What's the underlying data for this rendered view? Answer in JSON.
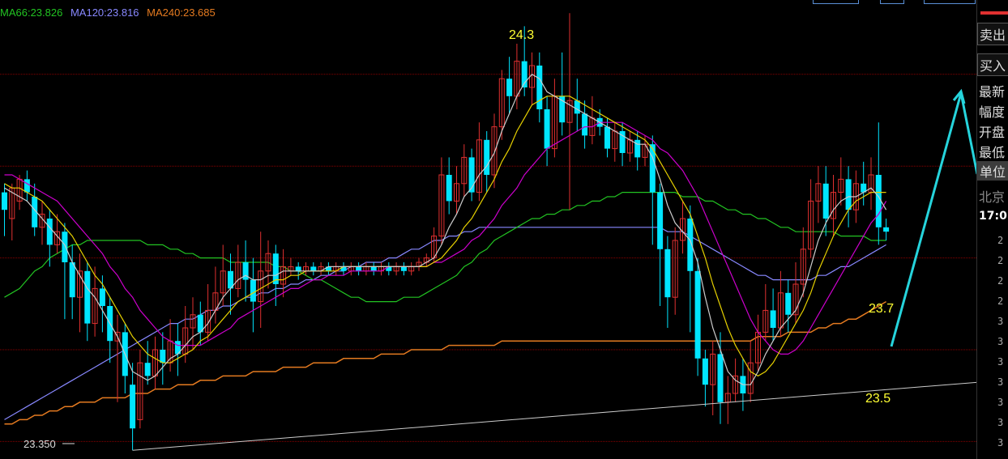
{
  "legend": [
    {
      "text": "MA66:23.826",
      "color": "#22c322"
    },
    {
      "text": "MA120:23.816",
      "color": "#8888ff"
    },
    {
      "text": "MA240:23.685",
      "color": "#e47a20"
    }
  ],
  "right_panel": {
    "sell_tab": "卖出",
    "buy_tab": "买入",
    "items": [
      "最新",
      "幅度",
      "开盘",
      "最低",
      "单位"
    ],
    "location": "北京",
    "time": "17:0",
    "rows": [
      "2",
      "2",
      "2",
      "2",
      "3",
      "3",
      "3",
      "3",
      "3",
      "3",
      "3"
    ]
  },
  "annotations": [
    {
      "label": "24.3",
      "color": "#ffff33"
    },
    {
      "label": "23.7",
      "color": "#ffff33"
    },
    {
      "label": "23.5",
      "color": "#ffff33"
    },
    {
      "label": "23.350",
      "color": "#dddddd"
    }
  ],
  "chart_data": {
    "type": "candlestick",
    "ylim": [
      23.33,
      24.38
    ],
    "n_candles": 118,
    "grid_levels": [
      24.21,
      24.0,
      23.79,
      23.58,
      23.37
    ],
    "colors": {
      "up": "#e03030",
      "down": "#00e5ff",
      "grid": "#8b0000",
      "price_line": "#cccccc",
      "ma_yellow": "#e6d000",
      "ma_magenta": "#cc00cc"
    },
    "candles": [
      [
        23.94,
        23.9,
        23.96,
        23.84
      ],
      [
        23.88,
        23.95,
        23.96,
        23.83
      ],
      [
        23.92,
        23.97,
        23.98,
        23.9
      ],
      [
        23.97,
        23.94,
        23.99,
        23.92
      ],
      [
        23.93,
        23.86,
        23.96,
        23.84
      ],
      [
        23.86,
        23.89,
        23.92,
        23.82
      ],
      [
        23.88,
        23.82,
        23.9,
        23.77
      ],
      [
        23.82,
        23.85,
        23.89,
        23.8
      ],
      [
        23.85,
        23.78,
        23.87,
        23.65
      ],
      [
        23.78,
        23.7,
        23.82,
        23.65
      ],
      [
        23.7,
        23.76,
        23.8,
        23.62
      ],
      [
        23.76,
        23.64,
        23.78,
        23.6
      ],
      [
        23.64,
        23.72,
        23.77,
        23.61
      ],
      [
        23.72,
        23.68,
        23.75,
        23.62
      ],
      [
        23.68,
        23.6,
        23.7,
        23.55
      ],
      [
        23.6,
        23.62,
        23.66,
        23.46
      ],
      [
        23.62,
        23.52,
        23.64,
        23.48
      ],
      [
        23.5,
        23.4,
        23.55,
        23.35
      ],
      [
        23.42,
        23.55,
        23.58,
        23.4
      ],
      [
        23.55,
        23.52,
        23.6,
        23.5
      ],
      [
        23.52,
        23.58,
        23.61,
        23.49
      ],
      [
        23.58,
        23.55,
        23.62,
        23.5
      ],
      [
        23.55,
        23.6,
        23.65,
        23.53
      ],
      [
        23.6,
        23.57,
        23.64,
        23.52
      ],
      [
        23.57,
        23.63,
        23.68,
        23.55
      ],
      [
        23.63,
        23.66,
        23.7,
        23.58
      ],
      [
        23.66,
        23.62,
        23.69,
        23.59
      ],
      [
        23.62,
        23.67,
        23.73,
        23.6
      ],
      [
        23.67,
        23.71,
        23.77,
        23.64
      ],
      [
        23.71,
        23.76,
        23.82,
        23.68
      ],
      [
        23.76,
        23.72,
        23.8,
        23.66
      ],
      [
        23.72,
        23.78,
        23.82,
        23.7
      ],
      [
        23.78,
        23.74,
        23.83,
        23.69
      ],
      [
        23.74,
        23.69,
        23.79,
        23.62
      ],
      [
        23.69,
        23.76,
        23.85,
        23.63
      ],
      [
        23.76,
        23.8,
        23.83,
        23.72
      ],
      [
        23.8,
        23.73,
        23.82,
        23.68
      ],
      [
        23.73,
        23.77,
        23.81,
        23.7
      ],
      [
        23.76,
        23.77,
        23.79,
        23.75
      ],
      [
        23.77,
        23.76,
        23.78,
        23.74
      ],
      [
        23.76,
        23.77,
        23.78,
        23.75
      ],
      [
        23.77,
        23.76,
        23.78,
        23.75
      ],
      [
        23.76,
        23.77,
        23.78,
        23.75
      ],
      [
        23.77,
        23.76,
        23.78,
        23.75
      ],
      [
        23.76,
        23.77,
        23.78,
        23.75
      ],
      [
        23.77,
        23.76,
        23.78,
        23.75
      ],
      [
        23.76,
        23.77,
        23.78,
        23.75
      ],
      [
        23.77,
        23.76,
        23.78,
        23.75
      ],
      [
        23.76,
        23.77,
        23.78,
        23.75
      ],
      [
        23.77,
        23.76,
        23.78,
        23.75
      ],
      [
        23.76,
        23.77,
        23.78,
        23.75
      ],
      [
        23.77,
        23.76,
        23.78,
        23.75
      ],
      [
        23.76,
        23.77,
        23.78,
        23.75
      ],
      [
        23.77,
        23.76,
        23.78,
        23.75
      ],
      [
        23.76,
        23.77,
        23.78,
        23.75
      ],
      [
        23.77,
        23.78,
        23.79,
        23.76
      ],
      [
        23.78,
        23.79,
        23.8,
        23.77
      ],
      [
        23.79,
        23.84,
        23.86,
        23.78
      ],
      [
        23.84,
        23.98,
        24.02,
        23.82
      ],
      [
        23.98,
        23.92,
        24.02,
        23.89
      ],
      [
        23.92,
        23.96,
        24.0,
        23.89
      ],
      [
        23.96,
        24.02,
        24.05,
        23.93
      ],
      [
        24.02,
        23.94,
        24.04,
        23.92
      ],
      [
        23.94,
        24.06,
        24.1,
        23.92
      ],
      [
        24.06,
        23.98,
        24.08,
        23.94
      ],
      [
        23.98,
        24.09,
        24.12,
        23.95
      ],
      [
        24.09,
        24.2,
        24.22,
        24.06
      ],
      [
        24.2,
        24.16,
        24.25,
        24.12
      ],
      [
        24.16,
        24.24,
        24.28,
        24.13
      ],
      [
        24.24,
        24.18,
        24.32,
        24.16
      ],
      [
        24.18,
        24.23,
        24.26,
        24.14
      ],
      [
        24.23,
        24.13,
        24.26,
        24.1
      ],
      [
        24.13,
        24.04,
        24.16,
        24.0
      ],
      [
        24.04,
        24.16,
        24.2,
        24.02
      ],
      [
        24.16,
        24.1,
        24.26,
        24.07
      ],
      [
        24.1,
        24.15,
        24.35,
        23.9
      ],
      [
        24.15,
        24.12,
        24.2,
        24.08
      ],
      [
        24.12,
        24.07,
        24.15,
        24.04
      ],
      [
        24.07,
        24.11,
        24.16,
        24.05
      ],
      [
        24.11,
        24.09,
        24.13,
        24.07
      ],
      [
        24.09,
        24.04,
        24.11,
        24.02
      ],
      [
        24.04,
        24.08,
        24.1,
        24.01
      ],
      [
        24.08,
        24.03,
        24.1,
        24.0
      ],
      [
        24.03,
        24.06,
        24.08,
        24.01
      ],
      [
        24.06,
        24.02,
        24.08,
        23.99
      ],
      [
        24.02,
        24.05,
        24.07,
        24.0
      ],
      [
        24.05,
        23.94,
        24.07,
        23.82
      ],
      [
        23.94,
        23.81,
        23.96,
        23.68
      ],
      [
        23.81,
        23.7,
        23.84,
        23.63
      ],
      [
        23.7,
        23.83,
        23.86,
        23.66
      ],
      [
        23.83,
        23.88,
        23.92,
        23.8
      ],
      [
        23.88,
        23.76,
        23.91,
        23.62
      ],
      [
        23.76,
        23.56,
        23.79,
        23.52
      ],
      [
        23.56,
        23.5,
        23.58,
        23.45
      ],
      [
        23.5,
        23.57,
        23.6,
        23.43
      ],
      [
        23.57,
        23.46,
        23.62,
        23.41
      ],
      [
        23.46,
        23.48,
        23.52,
        23.41
      ],
      [
        23.48,
        23.52,
        23.56,
        23.46
      ],
      [
        23.52,
        23.48,
        23.56,
        23.44
      ],
      [
        23.48,
        23.55,
        23.6,
        23.46
      ],
      [
        23.55,
        23.62,
        23.66,
        23.53
      ],
      [
        23.62,
        23.67,
        23.73,
        23.6
      ],
      [
        23.67,
        23.63,
        23.72,
        23.6
      ],
      [
        23.63,
        23.71,
        23.76,
        23.61
      ],
      [
        23.71,
        23.66,
        23.74,
        23.62
      ],
      [
        23.66,
        23.73,
        23.78,
        23.64
      ],
      [
        23.73,
        23.81,
        23.86,
        23.7
      ],
      [
        23.81,
        23.92,
        23.97,
        23.79
      ],
      [
        23.92,
        23.96,
        24.0,
        23.87
      ],
      [
        23.96,
        23.88,
        24.0,
        23.84
      ],
      [
        23.88,
        23.94,
        23.98,
        23.84
      ],
      [
        23.94,
        23.97,
        24.02,
        23.91
      ],
      [
        23.97,
        23.9,
        24.0,
        23.86
      ],
      [
        23.9,
        23.96,
        23.99,
        23.87
      ],
      [
        23.96,
        23.94,
        24.01,
        23.91
      ],
      [
        23.94,
        23.98,
        24.02,
        23.9
      ],
      [
        23.98,
        23.86,
        24.1,
        23.82
      ],
      [
        23.86,
        23.85,
        23.88,
        23.83
      ]
    ],
    "ma_white": [
      23.95,
      23.94,
      23.93,
      23.92,
      23.9,
      23.88,
      23.86,
      23.84,
      23.82,
      23.78,
      23.75,
      23.72,
      23.7,
      23.67,
      23.64,
      23.61,
      23.57,
      23.53,
      23.52,
      23.51,
      23.52,
      23.54,
      23.56,
      23.57,
      23.59,
      23.61,
      23.62,
      23.64,
      23.67,
      23.7,
      23.72,
      23.74,
      23.75,
      23.74,
      23.74,
      23.75,
      23.75,
      23.76,
      23.76,
      23.76,
      23.76,
      23.76,
      23.76,
      23.77,
      23.77,
      23.77,
      23.77,
      23.77,
      23.77,
      23.77,
      23.77,
      23.77,
      23.77,
      23.77,
      23.77,
      23.77,
      23.78,
      23.79,
      23.82,
      23.86,
      23.89,
      23.93,
      23.95,
      23.98,
      24.0,
      24.03,
      24.08,
      24.12,
      24.16,
      24.19,
      24.21,
      24.2,
      24.17,
      24.16,
      24.15,
      24.14,
      24.13,
      24.12,
      24.11,
      24.1,
      24.09,
      24.08,
      24.07,
      24.06,
      24.05,
      24.05,
      24.02,
      23.97,
      23.91,
      23.87,
      23.85,
      23.83,
      23.78,
      23.7,
      23.63,
      23.58,
      23.53,
      23.51,
      23.5,
      23.5,
      23.53,
      23.57,
      23.6,
      23.63,
      23.65,
      23.67,
      23.71,
      23.77,
      23.83,
      23.87,
      23.9,
      23.92,
      23.93,
      23.93,
      23.94,
      23.95,
      23.93,
      23.9
    ],
    "ma_yellow": [
      23.96,
      23.95,
      23.95,
      23.94,
      23.93,
      23.92,
      23.9,
      23.88,
      23.86,
      23.84,
      23.81,
      23.78,
      23.75,
      23.73,
      23.7,
      23.67,
      23.64,
      23.61,
      23.59,
      23.57,
      23.56,
      23.55,
      23.55,
      23.56,
      23.57,
      23.58,
      23.6,
      23.61,
      23.63,
      23.65,
      23.67,
      23.69,
      23.7,
      23.71,
      23.72,
      23.73,
      23.74,
      23.74,
      23.75,
      23.75,
      23.76,
      23.76,
      23.76,
      23.76,
      23.76,
      23.77,
      23.77,
      23.77,
      23.77,
      23.77,
      23.77,
      23.77,
      23.77,
      23.77,
      23.77,
      23.77,
      23.77,
      23.78,
      23.79,
      23.81,
      23.83,
      23.86,
      23.88,
      23.91,
      23.94,
      23.97,
      24.01,
      24.04,
      24.08,
      24.11,
      24.14,
      24.15,
      24.16,
      24.16,
      24.16,
      24.16,
      24.15,
      24.14,
      24.13,
      24.12,
      24.11,
      24.1,
      24.09,
      24.08,
      24.07,
      24.06,
      24.04,
      24.01,
      23.98,
      23.95,
      23.92,
      23.89,
      23.84,
      23.79,
      23.73,
      23.68,
      23.63,
      23.59,
      23.56,
      23.53,
      23.52,
      23.53,
      23.55,
      23.58,
      23.61,
      23.64,
      23.67,
      23.71,
      23.76,
      23.8,
      23.84,
      23.87,
      23.9,
      23.92,
      23.93,
      23.94,
      23.94,
      23.94
    ],
    "ma_magenta": [
      23.98,
      23.98,
      23.97,
      23.96,
      23.95,
      23.94,
      23.93,
      23.92,
      23.9,
      23.88,
      23.86,
      23.84,
      23.82,
      23.8,
      23.77,
      23.75,
      23.72,
      23.7,
      23.67,
      23.65,
      23.63,
      23.61,
      23.6,
      23.59,
      23.59,
      23.59,
      23.59,
      23.6,
      23.61,
      23.62,
      23.63,
      23.65,
      23.66,
      23.67,
      23.68,
      23.69,
      23.7,
      23.71,
      23.72,
      23.72,
      23.73,
      23.74,
      23.74,
      23.75,
      23.75,
      23.75,
      23.76,
      23.76,
      23.76,
      23.76,
      23.76,
      23.77,
      23.77,
      23.77,
      23.77,
      23.77,
      23.77,
      23.78,
      23.78,
      23.79,
      23.8,
      23.81,
      23.83,
      23.84,
      23.86,
      23.88,
      23.91,
      23.93,
      23.95,
      23.98,
      24.0,
      24.02,
      24.04,
      24.05,
      24.06,
      24.07,
      24.08,
      24.09,
      24.09,
      24.1,
      24.1,
      24.1,
      24.1,
      24.09,
      24.08,
      24.07,
      24.06,
      24.04,
      24.03,
      24.01,
      23.99,
      23.96,
      23.93,
      23.89,
      23.85,
      23.81,
      23.77,
      23.73,
      23.69,
      23.65,
      23.62,
      23.6,
      23.58,
      23.57,
      23.57,
      23.58,
      23.6,
      23.63,
      23.66,
      23.69,
      23.72,
      23.75,
      23.78,
      23.81,
      23.84,
      23.87,
      23.89,
      23.92
    ],
    "ma66": [
      23.7,
      23.71,
      23.72,
      23.74,
      23.76,
      23.77,
      23.79,
      23.8,
      23.81,
      23.82,
      23.82,
      23.83,
      23.83,
      23.83,
      23.83,
      23.83,
      23.83,
      23.83,
      23.83,
      23.82,
      23.82,
      23.82,
      23.81,
      23.81,
      23.8,
      23.8,
      23.79,
      23.79,
      23.79,
      23.79,
      23.78,
      23.78,
      23.78,
      23.78,
      23.78,
      23.78,
      23.77,
      23.77,
      23.76,
      23.76,
      23.75,
      23.74,
      23.74,
      23.73,
      23.72,
      23.71,
      23.7,
      23.7,
      23.69,
      23.69,
      23.69,
      23.69,
      23.69,
      23.7,
      23.7,
      23.7,
      23.71,
      23.72,
      23.73,
      23.74,
      23.75,
      23.77,
      23.78,
      23.8,
      23.81,
      23.83,
      23.84,
      23.85,
      23.86,
      23.87,
      23.88,
      23.88,
      23.89,
      23.89,
      23.9,
      23.9,
      23.91,
      23.91,
      23.92,
      23.92,
      23.93,
      23.93,
      23.94,
      23.94,
      23.94,
      23.94,
      23.94,
      23.94,
      23.94,
      23.94,
      23.93,
      23.93,
      23.93,
      23.92,
      23.92,
      23.91,
      23.9,
      23.9,
      23.89,
      23.89,
      23.88,
      23.88,
      23.87,
      23.86,
      23.86,
      23.85,
      23.85,
      23.85,
      23.85,
      23.85,
      23.85,
      23.84,
      23.84,
      23.84,
      23.84,
      23.83,
      23.83,
      23.83
    ],
    "ma120": [
      23.42,
      23.43,
      23.44,
      23.45,
      23.46,
      23.47,
      23.48,
      23.49,
      23.5,
      23.51,
      23.52,
      23.53,
      23.54,
      23.55,
      23.56,
      23.57,
      23.58,
      23.59,
      23.6,
      23.61,
      23.62,
      23.63,
      23.64,
      23.64,
      23.65,
      23.65,
      23.66,
      23.67,
      23.67,
      23.68,
      23.68,
      23.69,
      23.7,
      23.7,
      23.71,
      23.71,
      23.72,
      23.72,
      23.73,
      23.73,
      23.74,
      23.74,
      23.75,
      23.75,
      23.76,
      23.76,
      23.77,
      23.77,
      23.78,
      23.78,
      23.78,
      23.79,
      23.79,
      23.8,
      23.81,
      23.81,
      23.82,
      23.83,
      23.83,
      23.84,
      23.84,
      23.85,
      23.85,
      23.86,
      23.86,
      23.86,
      23.86,
      23.86,
      23.86,
      23.86,
      23.86,
      23.86,
      23.86,
      23.86,
      23.86,
      23.86,
      23.86,
      23.86,
      23.86,
      23.86,
      23.86,
      23.86,
      23.86,
      23.86,
      23.86,
      23.86,
      23.86,
      23.86,
      23.85,
      23.85,
      23.85,
      23.84,
      23.83,
      23.82,
      23.81,
      23.8,
      23.79,
      23.78,
      23.77,
      23.76,
      23.75,
      23.75,
      23.74,
      23.74,
      23.74,
      23.74,
      23.74,
      23.74,
      23.75,
      23.75,
      23.76,
      23.77,
      23.77,
      23.78,
      23.79,
      23.8,
      23.81,
      23.82
    ],
    "ma240": [
      23.41,
      23.41,
      23.42,
      23.42,
      23.43,
      23.43,
      23.44,
      23.44,
      23.45,
      23.45,
      23.46,
      23.46,
      23.46,
      23.47,
      23.47,
      23.47,
      23.47,
      23.48,
      23.48,
      23.48,
      23.49,
      23.49,
      23.49,
      23.5,
      23.5,
      23.5,
      23.51,
      23.51,
      23.51,
      23.52,
      23.52,
      23.52,
      23.52,
      23.53,
      23.53,
      23.53,
      23.53,
      23.54,
      23.54,
      23.54,
      23.54,
      23.55,
      23.55,
      23.55,
      23.55,
      23.56,
      23.56,
      23.56,
      23.56,
      23.56,
      23.57,
      23.57,
      23.57,
      23.57,
      23.58,
      23.58,
      23.58,
      23.58,
      23.58,
      23.59,
      23.59,
      23.59,
      23.59,
      23.59,
      23.59,
      23.59,
      23.6,
      23.6,
      23.6,
      23.6,
      23.6,
      23.6,
      23.6,
      23.6,
      23.6,
      23.6,
      23.6,
      23.6,
      23.6,
      23.6,
      23.6,
      23.6,
      23.6,
      23.6,
      23.6,
      23.6,
      23.6,
      23.6,
      23.6,
      23.6,
      23.6,
      23.6,
      23.6,
      23.6,
      23.6,
      23.6,
      23.6,
      23.6,
      23.6,
      23.6,
      23.61,
      23.61,
      23.61,
      23.61,
      23.62,
      23.62,
      23.62,
      23.62,
      23.63,
      23.63,
      23.64,
      23.64,
      23.65,
      23.65,
      23.66,
      23.67,
      23.68,
      23.69
    ],
    "trendline": {
      "from": {
        "index": 17,
        "price": 23.35
      },
      "to": {
        "index": 140,
        "price": 23.52
      }
    }
  }
}
